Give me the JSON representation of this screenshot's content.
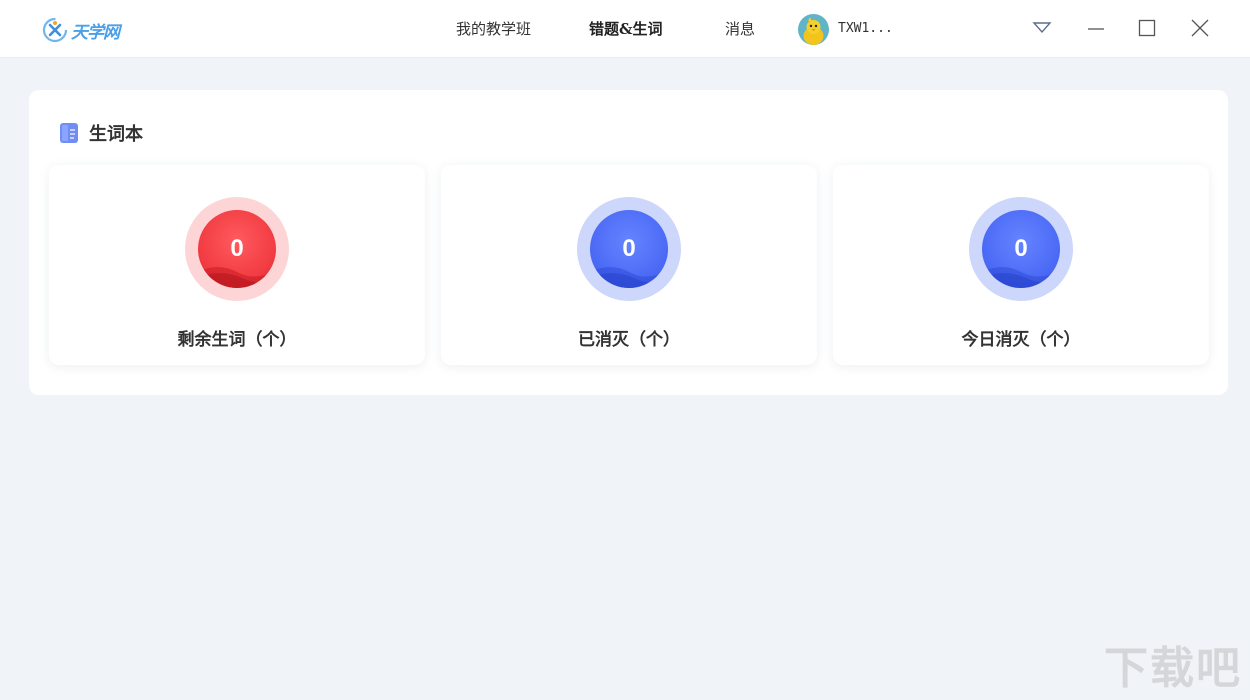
{
  "app": {
    "logo_text": "天学网"
  },
  "nav": {
    "items": [
      {
        "label": "我的教学班",
        "active": false
      },
      {
        "label": "错题&生词",
        "active": true
      },
      {
        "label": "消息",
        "active": false
      }
    ]
  },
  "user": {
    "name": "TXW1..."
  },
  "panel": {
    "title": "生词本",
    "cards": [
      {
        "value": "0",
        "label": "剩余生词（个）",
        "color": "#f23e44"
      },
      {
        "value": "0",
        "label": "已消灭（个）",
        "color": "#4d6cf6"
      },
      {
        "value": "0",
        "label": "今日消灭（个）",
        "color": "#4d6cf6"
      }
    ]
  },
  "watermark": {
    "text": "下载吧"
  },
  "colors": {
    "accent": "#4a9fe8",
    "background": "#f0f3f7"
  }
}
